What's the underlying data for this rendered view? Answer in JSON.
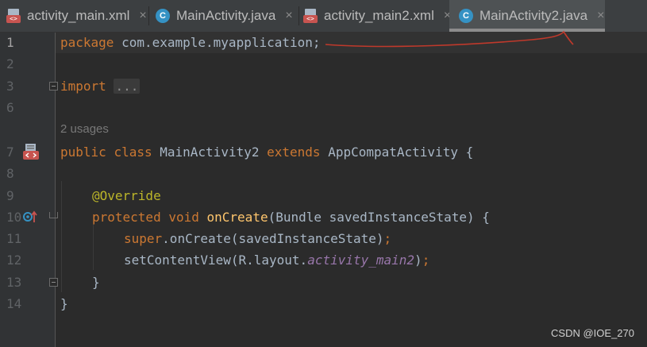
{
  "tabs": [
    {
      "label": "activity_main.xml",
      "icon": "xml-file-icon",
      "active": false
    },
    {
      "label": "MainActivity.java",
      "icon": "java-class-icon",
      "active": false
    },
    {
      "label": "activity_main2.xml",
      "icon": "xml-file-icon",
      "active": false
    },
    {
      "label": "MainActivity2.java",
      "icon": "java-class-icon",
      "active": true
    }
  ],
  "tab_close_glyph": "×",
  "class_icon_letter": "C",
  "xml_badge_text": "<>",
  "line_numbers": [
    "1",
    "2",
    "3",
    "6",
    "7",
    "8",
    "9",
    "10",
    "11",
    "12",
    "13",
    "14"
  ],
  "code": {
    "l1_kw": "package",
    "l1_rest": " com.example.myapplication;",
    "l3_kw": "import",
    "l3_folded": "...",
    "usages": "2 usages",
    "l7_kw1": "public",
    "l7_kw2": "class",
    "l7_name": "MainActivity2",
    "l7_kw3": "extends",
    "l7_rest": " AppCompatActivity {",
    "l9_ann": "@Override",
    "l10_kw1": "protected",
    "l10_kw2": "void",
    "l10_fn": "onCreate",
    "l10_rest": "(Bundle savedInstanceState) {",
    "l11_kw": "super",
    "l11_rest": ".onCreate(savedInstanceState)",
    "l11_semi": ";",
    "l12_rest": "setContentView(R.layout.",
    "l12_field": "activity_main2",
    "l12_end": ")",
    "l12_semi": ";",
    "l13": "}",
    "l14": "}"
  },
  "watermark": "CSDN @IOE_270",
  "colors": {
    "keyword": "#cc7832",
    "annotation": "#bbb529",
    "method": "#ffc66d",
    "field": "#9876aa",
    "text": "#a9b7c6",
    "background": "#2b2b2b",
    "annotation_stroke": "#c0392b"
  }
}
